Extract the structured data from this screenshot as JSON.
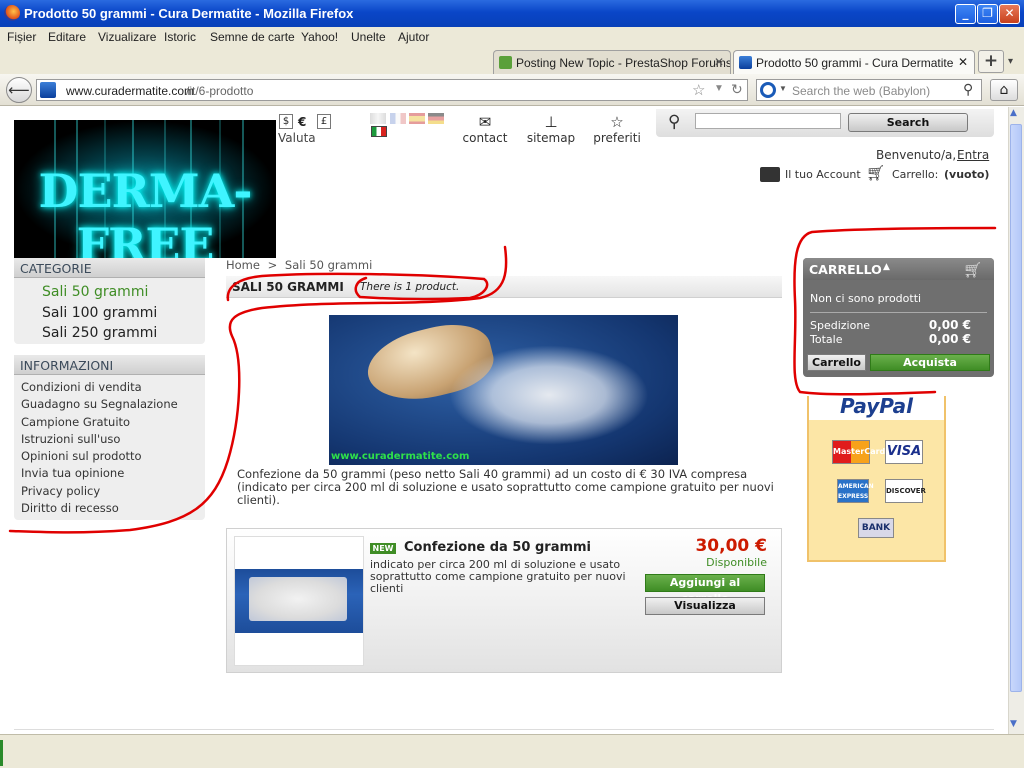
{
  "window": {
    "title": "Prodotto 50 grammi - Cura Dermatite - Mozilla Firefox"
  },
  "menu": [
    "Fișier",
    "Editare",
    "Vizualizare",
    "Istoric",
    "Semne de carte",
    "Yahoo!",
    "Unelte",
    "Ajutor"
  ],
  "tabs": [
    {
      "label": "Posting New Topic - PrestaShop Forums"
    },
    {
      "label": "Prodotto 50 grammi - Cura Dermatite"
    }
  ],
  "nav": {
    "url_host": "www.curadermatite.com",
    "url_path": "/it/6-prodotto",
    "search_placeholder": "Search the web (Babylon)"
  },
  "header": {
    "logo_text": "DERMA-FREE",
    "currencies": [
      "$",
      "€",
      "£"
    ],
    "currency_label": "Valuta",
    "links": [
      {
        "label": "contact",
        "icon": "envelope-icon"
      },
      {
        "label": "sitemap",
        "icon": "sitemap-icon"
      },
      {
        "label": "preferiti",
        "icon": "star-icon"
      }
    ],
    "search_button": "Search",
    "welcome": "Benvenuto/a,",
    "login_link": "Entra",
    "account_link": "Il tuo Account",
    "cart_label": "Carrello:",
    "cart_state": "(vuoto)"
  },
  "categories": {
    "title": "CATEGORIE",
    "items": [
      "Sali 50 grammi",
      "Sali 100 grammi",
      "Sali 250 grammi"
    ]
  },
  "info": {
    "title": "INFORMAZIONI",
    "items": [
      "Condizioni di vendita",
      "Guadagno su Segnalazione",
      "Campione Gratuito",
      "Istruzioni sull'uso",
      "Opinioni sul prodotto",
      "Invia tua opinione",
      "Privacy policy",
      "Diritto di recesso"
    ]
  },
  "breadcrumb": {
    "home": "Home",
    "sep": ">",
    "current": "Sali 50 grammi"
  },
  "category_heading": {
    "title": "SALI 50 GRAMMI",
    "count": "There is 1 product."
  },
  "category_image": {
    "watermark": "www.curadermatite.com"
  },
  "category_description": "Confezione da 50 grammi (peso netto Sali 40 grammi) ad un costo di € 30 IVA compresa (indicato per circa 200 ml di soluzione e usato soprattutto come campione gratuito per nuovi clienti).",
  "product": {
    "badge": "NEW",
    "name": "Confezione da 50 grammi",
    "desc": "indicato per circa 200 ml di soluzione e usato soprattutto come campione gratuito per nuovi clienti",
    "price": "30,00 €",
    "availability": "Disponibile",
    "add_button": "Aggiungi al carrello",
    "view_button": "Visualizza"
  },
  "cart": {
    "title": "CARRELLO",
    "empty": "Non ci sono prodotti",
    "shipping_label": "Spedizione",
    "shipping_value": "0,00 €",
    "total_label": "Totale",
    "total_value": "0,00 €",
    "cart_button": "Carrello",
    "buy_button": "Acquista"
  },
  "paypal": {
    "title": "PayPal",
    "cards": [
      "MasterCard",
      "VISA",
      "AMERICAN EXPRESS",
      "DISCOVER",
      "BANK"
    ]
  },
  "colors": {
    "accent_green": "#3f8d25",
    "price_red": "#cc1a00",
    "annotation_red": "#e00000",
    "titlebar_blue": "#0a46c8"
  }
}
